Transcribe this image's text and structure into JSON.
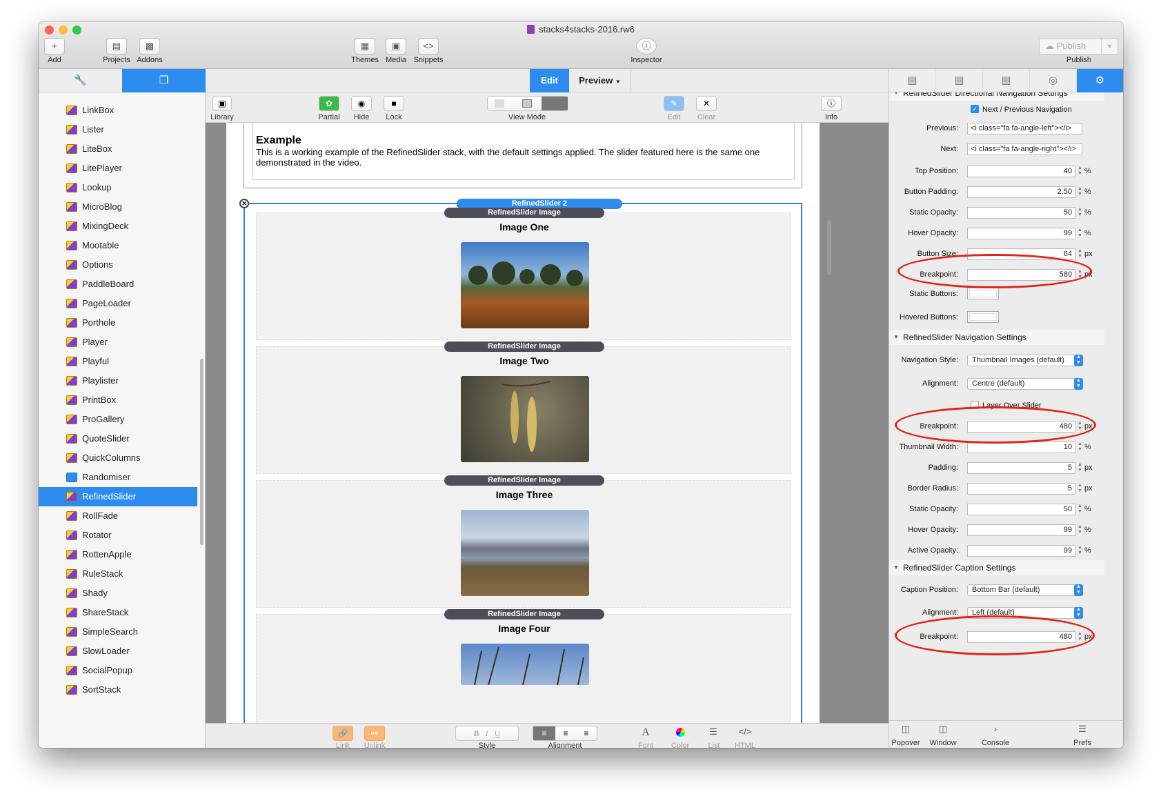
{
  "window": {
    "title": "stacks4stacks-2016.rw6"
  },
  "toolbar": {
    "add": "Add",
    "projects": "Projects",
    "addons": "Addons",
    "themes": "Themes",
    "media": "Media",
    "snippets": "Snippets",
    "inspector": "Inspector",
    "publish_btn": "Publish",
    "publish_lbl": "Publish"
  },
  "sidebar": {
    "items": [
      "LinkBox",
      "Lister",
      "LiteBox",
      "LitePlayer",
      "Lookup",
      "MicroBlog",
      "MixingDeck",
      "Mootable",
      "Options",
      "PaddleBoard",
      "PageLoader",
      "Porthole",
      "Player",
      "Playful",
      "Playlister",
      "PrintBox",
      "ProGallery",
      "QuoteSlider",
      "QuickColumns",
      "Randomiser",
      "RefinedSlider",
      "RollFade",
      "Rotator",
      "RottenApple",
      "RuleStack",
      "Shady",
      "ShareStack",
      "SimpleSearch",
      "SlowLoader",
      "SocialPopup",
      "SortStack"
    ],
    "selected": "RefinedSlider"
  },
  "modebar": {
    "edit": "Edit",
    "preview": "Preview"
  },
  "center_tools": {
    "library": "Library",
    "partial": "Partial",
    "hide": "Hide",
    "lock": "Lock",
    "view_mode": "View Mode",
    "edit": "Edit",
    "clear": "Clear",
    "info": "Info"
  },
  "canvas": {
    "example_heading": "Example",
    "example_text": "This is a working example of the RefinedSlider stack, with the default settings applied. The slider featured here is the same one demonstrated in the video.",
    "slider_label": "RefinedSlider 2",
    "slides": [
      {
        "label": "RefinedSlider Image",
        "title": "Image One"
      },
      {
        "label": "RefinedSlider Image",
        "title": "Image Two"
      },
      {
        "label": "RefinedSlider Image",
        "title": "Image Three"
      },
      {
        "label": "RefinedSlider Image",
        "title": "Image Four"
      }
    ]
  },
  "bottom_tools": {
    "link": "Link",
    "unlink": "Unlink",
    "style": "Style",
    "alignment": "Alignment",
    "font": "Font",
    "color": "Color",
    "list": "List",
    "html": "HTML"
  },
  "inspector": {
    "section_directional": "RefinedSlider Directional Navigation Settings",
    "next_prev_label": "Next / Previous Navigation",
    "previous_label": "Previous:",
    "previous_value": "<i class=\"fa fa-angle-left\"></i>",
    "next_label": "Next:",
    "next_value": "<i class=\"fa fa-angle-right\"></i>",
    "dir_rows": [
      {
        "label": "Top Position:",
        "value": "40",
        "unit": "%"
      },
      {
        "label": "Button Padding:",
        "value": "2.50",
        "unit": "%"
      },
      {
        "label": "Static Opacity:",
        "value": "50",
        "unit": "%"
      },
      {
        "label": "Hover Opacity:",
        "value": "99",
        "unit": "%"
      },
      {
        "label": "Button Size:",
        "value": "64",
        "unit": "px"
      },
      {
        "label": "Breakpoint:",
        "value": "580",
        "unit": "px"
      }
    ],
    "static_buttons_label": "Static Buttons:",
    "hovered_buttons_label": "Hovered Buttons:",
    "section_navigation": "RefinedSlider Navigation Settings",
    "nav_style_label": "Navigation Style:",
    "nav_style_value": "Thumbnail Images (default)",
    "nav_align_label": "Alignment:",
    "nav_align_value": "Centre (default)",
    "layer_over_label": "Layer Over Slider",
    "nav_rows": [
      {
        "label": "Breakpoint:",
        "value": "480",
        "unit": "px"
      },
      {
        "label": "Thumbnail Width:",
        "value": "10",
        "unit": "%"
      },
      {
        "label": "Padding:",
        "value": "5",
        "unit": "px"
      },
      {
        "label": "Border Radius:",
        "value": "5",
        "unit": "px"
      },
      {
        "label": "Static Opacity:",
        "value": "50",
        "unit": "%"
      },
      {
        "label": "Hover Opacity:",
        "value": "99",
        "unit": "%"
      },
      {
        "label": "Active Opacity:",
        "value": "99",
        "unit": "%"
      }
    ],
    "section_caption": "RefinedSlider Caption Settings",
    "cap_pos_label": "Caption Position:",
    "cap_pos_value": "Bottom Bar (default)",
    "cap_align_label": "Alignment:",
    "cap_align_value": "Left (default)",
    "cap_break_label": "Breakpoint:",
    "cap_break_value": "480",
    "cap_break_unit": "px",
    "bottom": {
      "popover": "Popover",
      "window": "Window",
      "console": "Console",
      "prefs": "Prefs"
    }
  },
  "colors": {
    "accent": "#2d8cf0",
    "annotation_ring": "#e1231a"
  }
}
